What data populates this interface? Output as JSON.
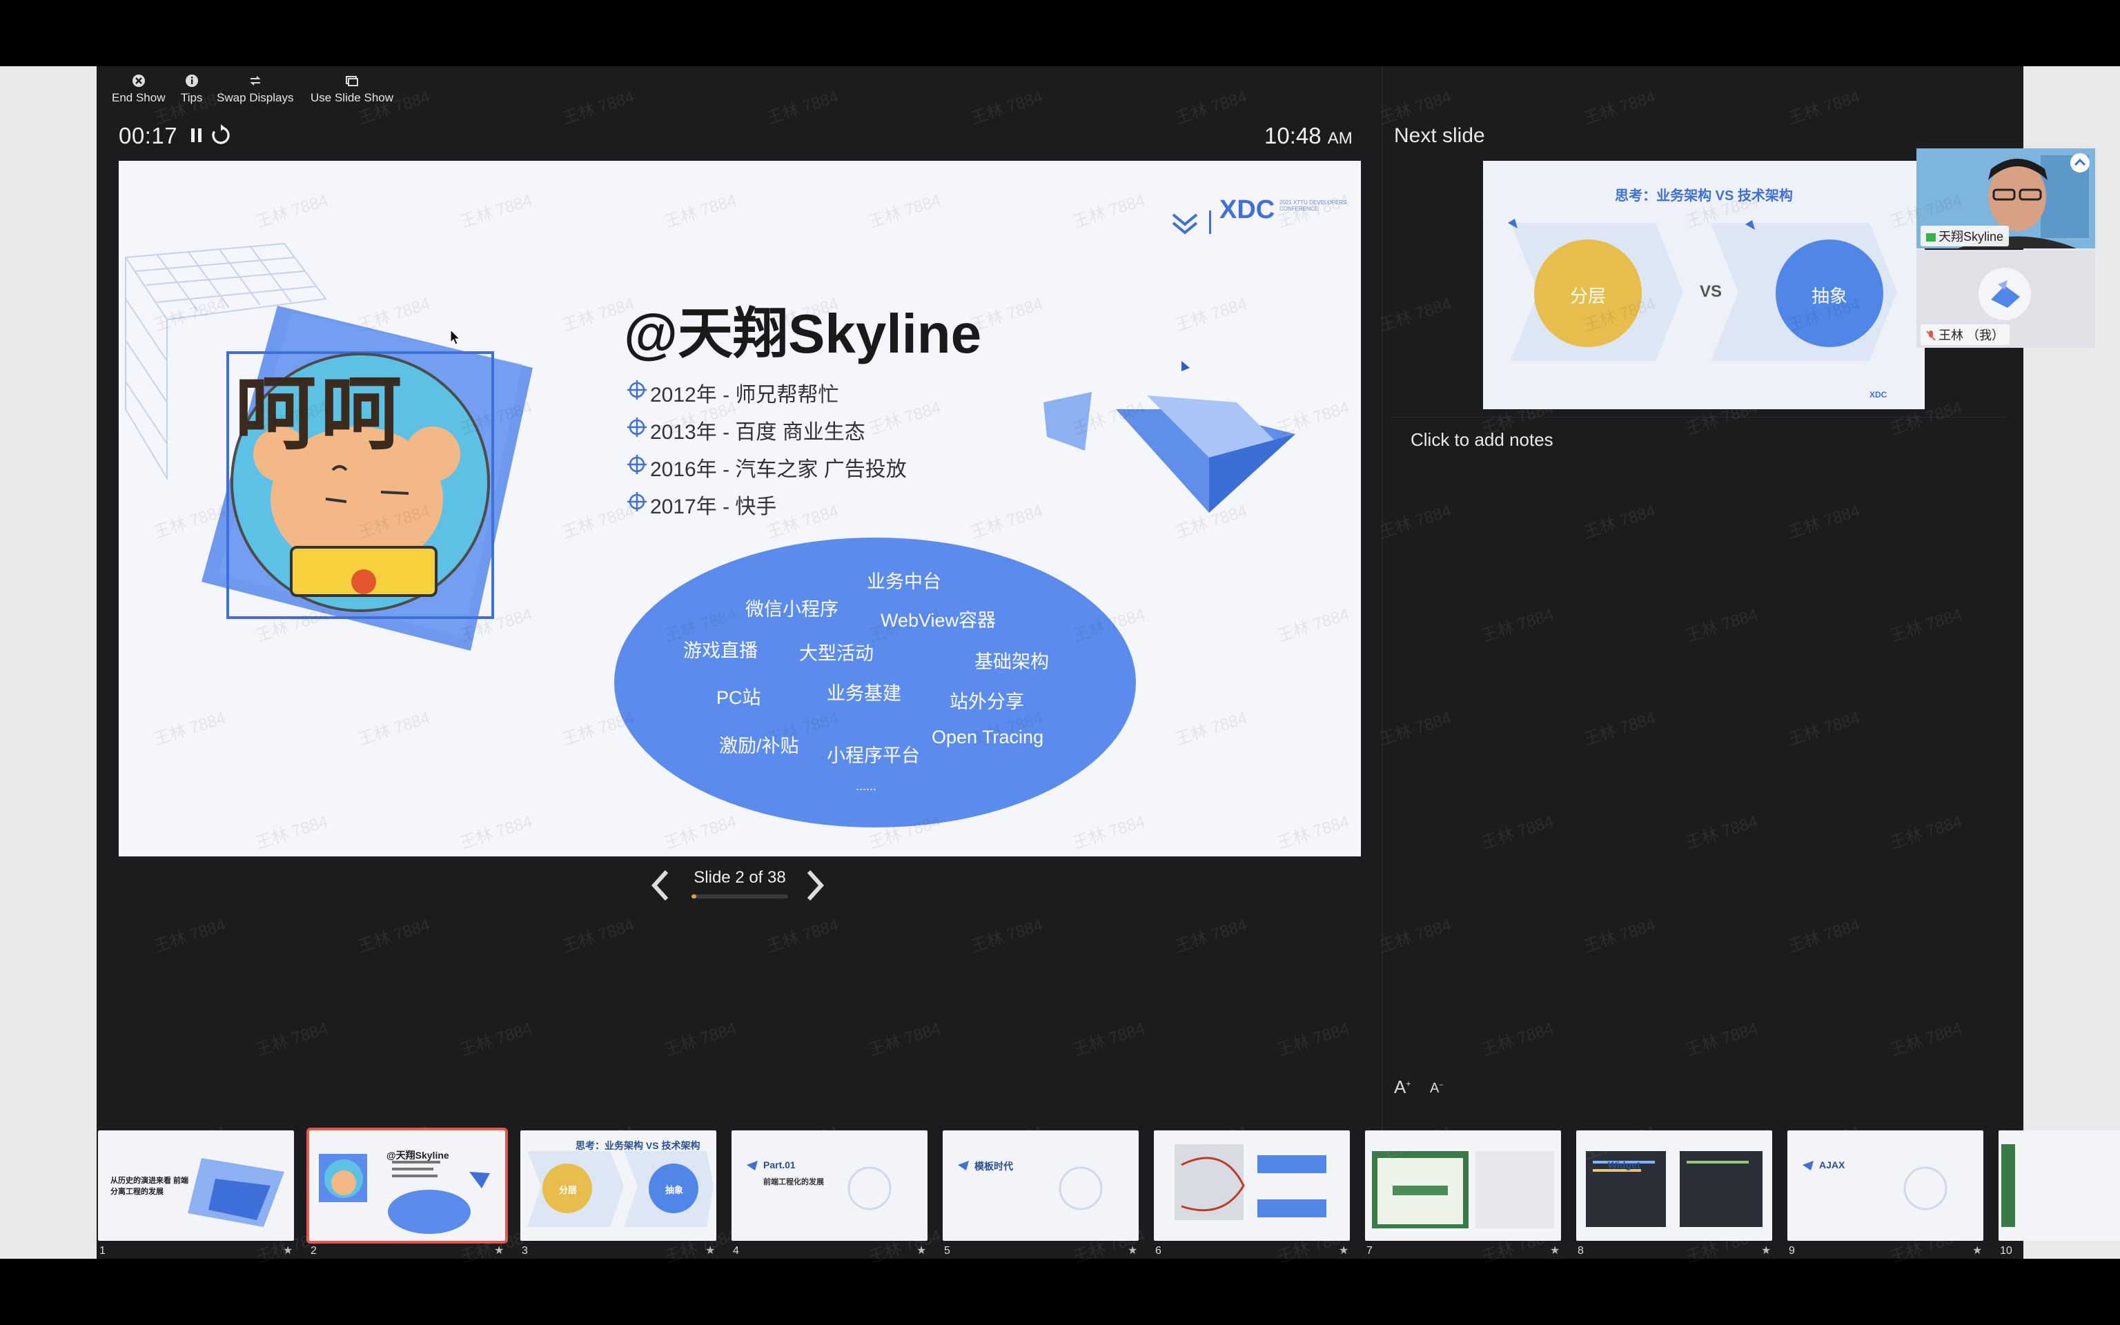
{
  "toolbar": {
    "end_show": "End Show",
    "tips": "Tips",
    "swap_displays": "Swap Displays",
    "use_slide_show": "Use Slide Show"
  },
  "presenter": {
    "timer": "00:17",
    "clock_time": "10:48",
    "clock_ampm": "AM",
    "next_slide_label": "Next slide",
    "notes_placeholder": "Click to add notes",
    "font_increase": "A",
    "font_decrease": "A"
  },
  "current_slide": {
    "brand": "XDC",
    "brand_sub": "2021 XTTU DEVELOPERS CONFERENCE",
    "title": "@天翔Skyline",
    "bullets": [
      "2012年 - 师兄帮帮忙",
      "2013年 - 百度 商业生态",
      "2016年 - 汽车之家 广告投放",
      "2017年 - 快手"
    ],
    "avatar_text": "呵呵",
    "ellipse_words": [
      "业务中台",
      "微信小程序",
      "WebView容器",
      "游戏直播",
      "大型活动",
      "基础架构",
      "PC站",
      "业务基建",
      "站外分享",
      "激励/补贴",
      "小程序平台",
      "Open Tracing",
      "......"
    ]
  },
  "navigation": {
    "slide_counter": "Slide 2 of 38",
    "progress_fraction": 0.053
  },
  "next_slide": {
    "title": "思考：业务架构 VS 技术架构",
    "left_circle": "分层",
    "vs": "VS",
    "right_circle": "抽象",
    "footer": "XDC"
  },
  "participants": [
    {
      "name": "天翔Skyline"
    },
    {
      "name": "王林 （我）"
    }
  ],
  "watermark": "王林 7884",
  "filmstrip": [
    {
      "num": "1",
      "label": "从历史的演进来看 前端分离工程的发展"
    },
    {
      "num": "2",
      "label": "@天翔Skyline"
    },
    {
      "num": "3",
      "label": "思考：业务架构 VS 技术架构",
      "c1": "分层",
      "c2": "抽象"
    },
    {
      "num": "4",
      "label": "Part.01",
      "sub": "前端工程化的发展"
    },
    {
      "num": "5",
      "label": "模板时代"
    },
    {
      "num": "6",
      "label": ""
    },
    {
      "num": "7",
      "label": ""
    },
    {
      "num": "8",
      "label": "Widget"
    },
    {
      "num": "9",
      "label": "AJAX"
    },
    {
      "num": "10",
      "label": ""
    }
  ],
  "colors": {
    "accent_blue": "#5b8ced",
    "gold": "#e7bd4d",
    "selected_border": "#e0584b",
    "app_bg": "#1c1c1e"
  }
}
